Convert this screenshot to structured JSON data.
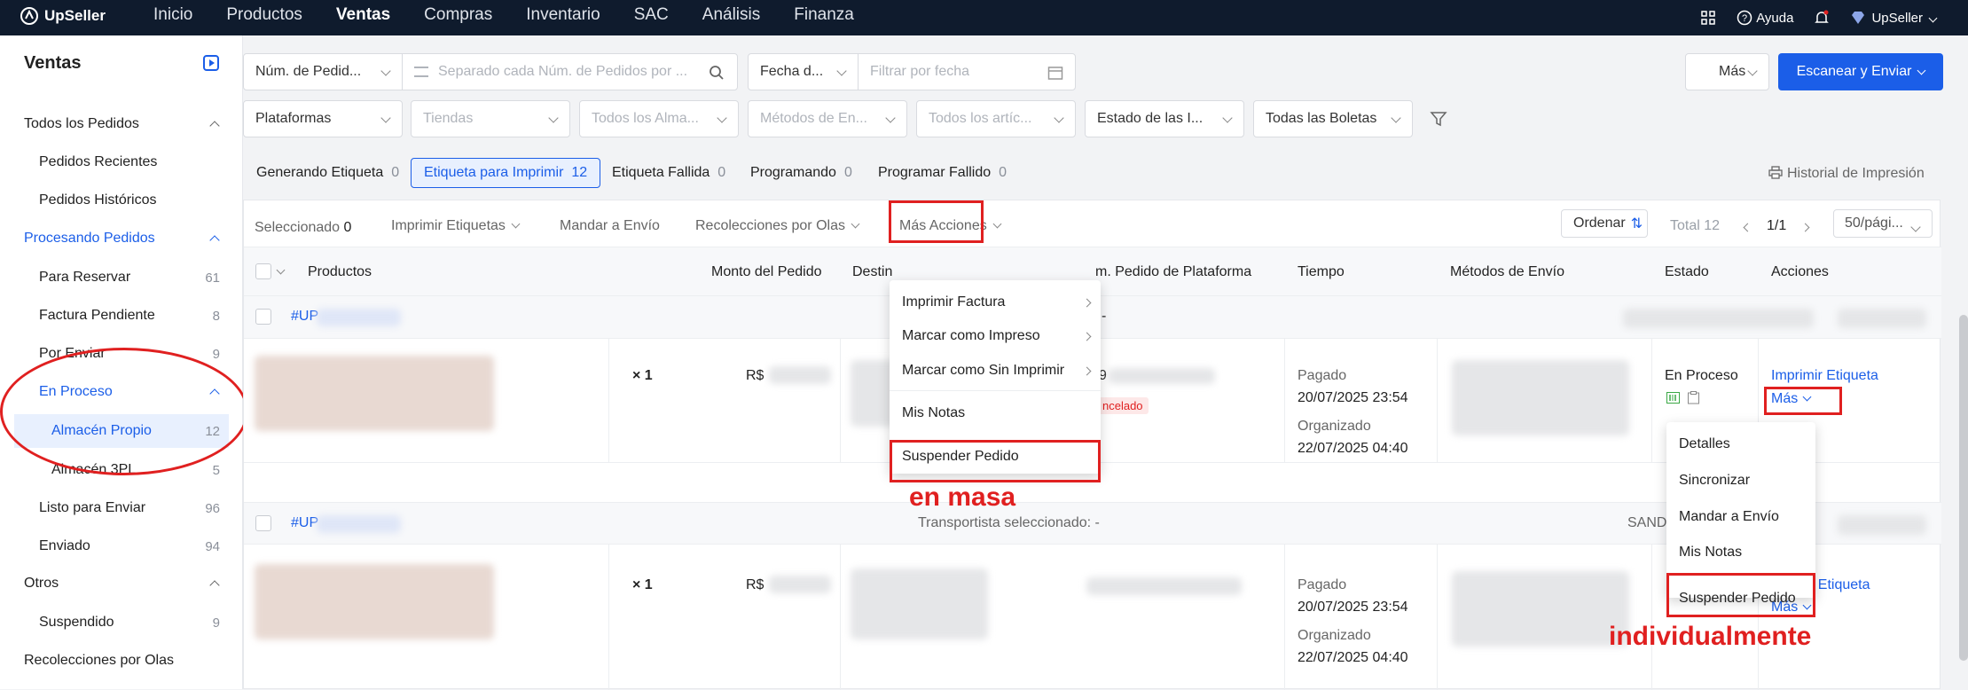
{
  "nav": {
    "logo": "UpSeller",
    "menu": [
      "Inicio",
      "Productos",
      "Ventas",
      "Compras",
      "Inventario",
      "SAC",
      "Análisis",
      "Finanza"
    ],
    "help": "Ayuda",
    "user": "UpSeller"
  },
  "sidebar": {
    "title": "Ventas",
    "items": [
      {
        "label": "Todos los Pedidos",
        "count": ""
      },
      {
        "label": "Pedidos Recientes",
        "count": ""
      },
      {
        "label": "Pedidos Históricos",
        "count": ""
      },
      {
        "label": "Procesando Pedidos",
        "count": ""
      },
      {
        "label": "Para Reservar",
        "count": "61"
      },
      {
        "label": "Factura Pendiente",
        "count": "8"
      },
      {
        "label": "Por Enviar",
        "count": "9"
      },
      {
        "label": "En Proceso",
        "count": ""
      },
      {
        "label": "Almacén Propio",
        "count": "12"
      },
      {
        "label": "Almacén 3PL",
        "count": "5"
      },
      {
        "label": "Listo para Enviar",
        "count": "96"
      },
      {
        "label": "Enviado",
        "count": "94"
      },
      {
        "label": "Otros",
        "count": ""
      },
      {
        "label": "Suspendido",
        "count": "9"
      },
      {
        "label": "Recolecciones por Olas",
        "count": ""
      }
    ]
  },
  "filters": {
    "order_num_select": "Núm. de Pedid...",
    "order_num_placeholder": "Separado cada Núm. de Pedidos por ...",
    "date_select": "Fecha d...",
    "date_placeholder": "Filtrar por fecha",
    "more": "Más",
    "scan_ship": "Escanear y Enviar",
    "platforms": "Plataformas",
    "stores": "Tiendas",
    "warehouses": "Todos los Alma...",
    "shipping_methods": "Métodos de En...",
    "all_items": "Todos los artíc...",
    "label_state": "Estado de las I...",
    "all_slips": "Todas las Boletas"
  },
  "tabs": [
    {
      "label": "Generando Etiqueta",
      "count": "0"
    },
    {
      "label": "Etiqueta para Imprimir",
      "count": "12"
    },
    {
      "label": "Etiqueta Fallida",
      "count": "0"
    },
    {
      "label": "Programando",
      "count": "0"
    },
    {
      "label": "Programar Fallido",
      "count": "0"
    }
  ],
  "print_history": "Historial de Impresión",
  "toolbar": {
    "selected_label": "Seleccionado",
    "selected_count": "0",
    "print_labels": "Imprimir Etiquetas",
    "send_to_ship": "Mandar a Envío",
    "wave_pickups": "Recolecciones por Olas",
    "more_actions": "Más Acciones",
    "order": "Ordenar",
    "total": "Total 12",
    "page": "1/1",
    "per_page": "50/pági..."
  },
  "table": {
    "headers": [
      "Productos",
      "Monto del Pedido",
      "Destin",
      "m. Pedido de Plataforma",
      "Tiempo",
      "Métodos de Envío",
      "Estado",
      "Acciones"
    ]
  },
  "orders": [
    {
      "id": "#UP",
      "qty": "× 1",
      "currency": "R$",
      "paid_label": "Pagado",
      "paid_time": "20/07/2025 23:54",
      "org_label": "Organizado",
      "org_time": "22/07/2025 04:40",
      "status": "En Proceso",
      "print_label": "Imprimir Etiqueta",
      "more": "Más",
      "platform_num": "9",
      "cancel_tag": "ncelado"
    },
    {
      "id": "#UP",
      "qty": "× 1",
      "currency": "R$",
      "paid_label": "Pagado",
      "paid_time": "20/07/2025 23:54",
      "org_label": "Organizado",
      "org_time": "22/07/2025 04:40",
      "carrier": "Transportista seleccionado: -",
      "sand": "SAND",
      "print_label": "r Etiqueta",
      "more": "Más"
    }
  ],
  "dash": "-",
  "bulk_menu": [
    "Imprimir Factura",
    "Marcar como Impreso",
    "Marcar como Sin Imprimir",
    "Mis Notas",
    "Suspender Pedido"
  ],
  "row_menu": [
    "Detalles",
    "Sincronizar",
    "Mandar a Envío",
    "Mis Notas",
    "Suspender Pedido"
  ],
  "annotations": {
    "bulk": "en masa",
    "individual": "individualmente"
  },
  "colors": {
    "accent": "#1b5ee8",
    "nav": "#0f1b2d",
    "annotation": "#e02020"
  }
}
